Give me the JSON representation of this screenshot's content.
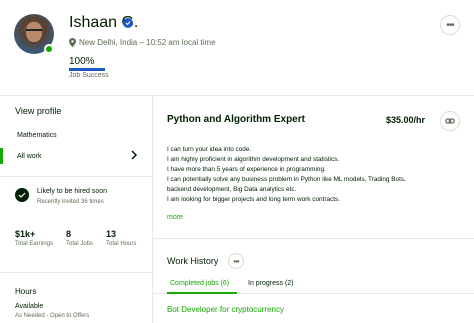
{
  "profile": {
    "name": "Ishaan G.",
    "location": "New Delhi, India – 10:52 am local time",
    "job_success_pct": "100%",
    "job_success_value": 1.0,
    "job_success_label": "Job Success"
  },
  "sidebar": {
    "heading": "View profile",
    "categories": [
      {
        "label": "Mathematics"
      },
      {
        "label": "All work"
      }
    ],
    "hire": {
      "title": "Likely to be hired soon",
      "subtitle": "Recently invited 36 times"
    },
    "stats": [
      {
        "value": "$1k+",
        "label": "Total Earnings"
      },
      {
        "value": "8",
        "label": "Total Jobs"
      },
      {
        "value": "13",
        "label": "Total Hours"
      }
    ],
    "hours": {
      "heading": "Hours",
      "availability": "Available",
      "detail": "As Needed - Open to Offers"
    }
  },
  "main": {
    "title": "Python and Algorithm Expert",
    "rate": "$35.00/hr",
    "description": [
      "I can turn your idea into code.",
      "I am highly proficient in algorithm development and statistics.",
      "I have more than 5 years of experience in programming.",
      "I can potentially solve any business problem in Python like ML models, Trading Bots,",
      "backend development, Big Data analytics etc.",
      "I am looking for bigger projects and long term work contracts."
    ],
    "more_label": "more",
    "work_history": {
      "title": "Work History",
      "tabs": [
        {
          "label": "Completed jobs (6)"
        },
        {
          "label": "In progress (2)"
        }
      ],
      "first_job": "Bot Developer for cryptocurrency"
    }
  },
  "colors": {
    "brand_green": "#14a800",
    "verified_blue": "#1f57c3",
    "text_dark": "#001e00",
    "text_muted": "#5e6d55"
  },
  "icons": [
    "verified-badge-icon",
    "location-pin-icon",
    "more-options-icon",
    "chevron-right-icon",
    "hire-badge-icon",
    "link-icon"
  ]
}
